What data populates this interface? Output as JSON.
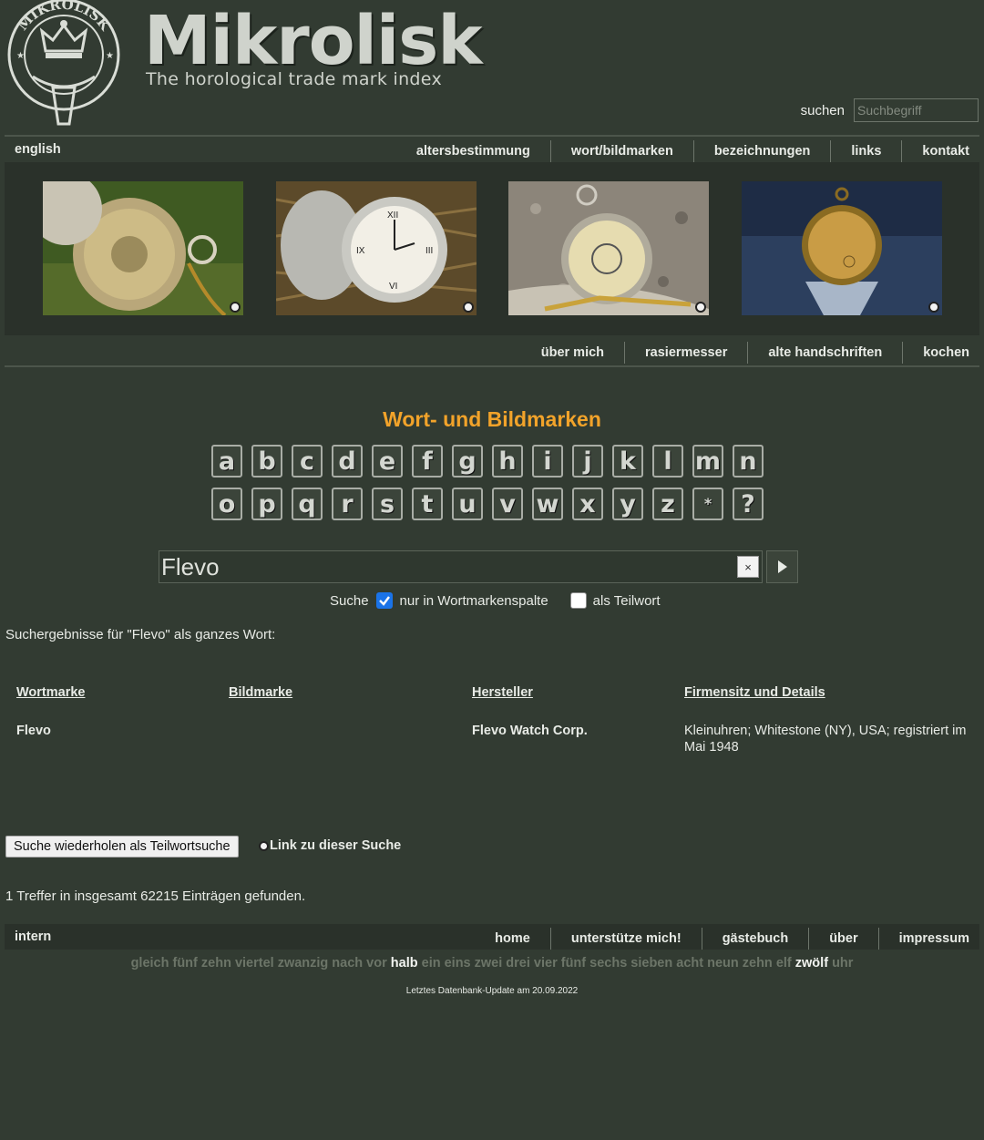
{
  "header": {
    "logo_text": "MIKROLISK",
    "title": "Mikrolisk",
    "subtitle": "The horological trade mark index",
    "search_label": "suchen",
    "search_placeholder": "Suchbegriff"
  },
  "top_nav": {
    "language": "english",
    "items": [
      "altersbestimmung",
      "wort/bildmarken",
      "bezeichnungen",
      "links",
      "kontakt"
    ]
  },
  "sub_nav": {
    "items": [
      "über mich",
      "rasiermesser",
      "alte handschriften",
      "kochen"
    ]
  },
  "main": {
    "heading": "Wort- und Bildmarken",
    "letters_row1": [
      "a",
      "b",
      "c",
      "d",
      "e",
      "f",
      "g",
      "h",
      "i",
      "j",
      "k",
      "l",
      "m",
      "n"
    ],
    "letters_row2": [
      "o",
      "p",
      "q",
      "r",
      "s",
      "t",
      "u",
      "v",
      "w",
      "x",
      "y",
      "z",
      "*",
      "?"
    ],
    "search_value": "Flevo",
    "clear_label": "×",
    "option_prefix": "Suche",
    "option_wortmarke": "nur in Wortmarkenspalte",
    "option_teilwort": "als Teilwort",
    "option_wortmarke_checked": true,
    "option_teilwort_checked": false,
    "results_caption": "Suchergebnisse für \"Flevo\" als ganzes Wort:"
  },
  "table": {
    "headers": [
      "Wortmarke",
      "Bildmarke",
      "Hersteller",
      "Firmensitz und Details"
    ],
    "rows": [
      {
        "wortmarke": "Flevo",
        "bildmarke": "",
        "hersteller": "Flevo Watch Corp.",
        "details": "Kleinuhren; Whitestone (NY), USA; registriert im Mai 1948"
      }
    ]
  },
  "actions": {
    "repeat_button": "Suche wiederholen als Teilwortsuche",
    "link_label": "Link zu dieser Suche",
    "hits_text": "1 Treffer in insgesamt 62215 Einträgen gefunden."
  },
  "footer": {
    "left": "intern",
    "items": [
      "home",
      "unterstütze mich!",
      "gästebuch",
      "über",
      "impressum"
    ],
    "clock_words_before": "gleich fünf zehn viertel zwanzig nach vor",
    "clock_highlight_1": "halb",
    "clock_words_middle": "ein eins zwei drei vier fünf sechs sieben acht neun zehn elf",
    "clock_highlight_2": "zwölf",
    "clock_words_after": "uhr",
    "update_text": "Letztes Datenbank-Update am 20.09.2022"
  },
  "colors": {
    "background": "#323b32",
    "accent_heading": "#f2a32a",
    "checkbox_blue": "#1a73e8"
  }
}
